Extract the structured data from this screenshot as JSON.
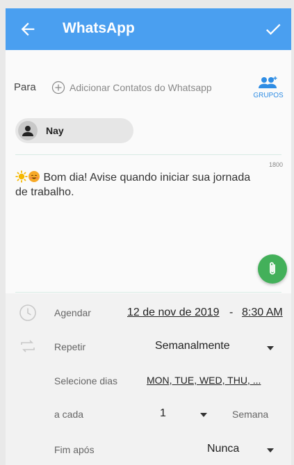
{
  "appbar": {
    "title": "WhatsApp",
    "color": "#4a9ff0"
  },
  "recipients": {
    "label": "Para",
    "add_contacts": "Adicionar Contatos do Whatsapp",
    "groups_label": "GRUPOS",
    "contact_chip": "Nay"
  },
  "message": {
    "char_counter": "1800",
    "emoji": [
      "sun",
      "smiling-face"
    ],
    "text": "Bom dia! Avise quando iniciar sua jornada de trabalho."
  },
  "schedule": {
    "label": "Agendar",
    "date": "12 de nov de 2019",
    "separator": "-",
    "time": "8:30 AM"
  },
  "repeat": {
    "label": "Repetir",
    "value": "Semanalmente"
  },
  "days": {
    "label": "Selecione dias",
    "value": "MON, TUE, WED, THU, ..."
  },
  "interval": {
    "label": "a cada",
    "value": "1",
    "unit": "Semana"
  },
  "end": {
    "label": "Fim após",
    "value": "Nunca"
  },
  "colors": {
    "accent": "#4a9ff0",
    "attach": "#43b05a",
    "groups": "#2f8de4"
  }
}
